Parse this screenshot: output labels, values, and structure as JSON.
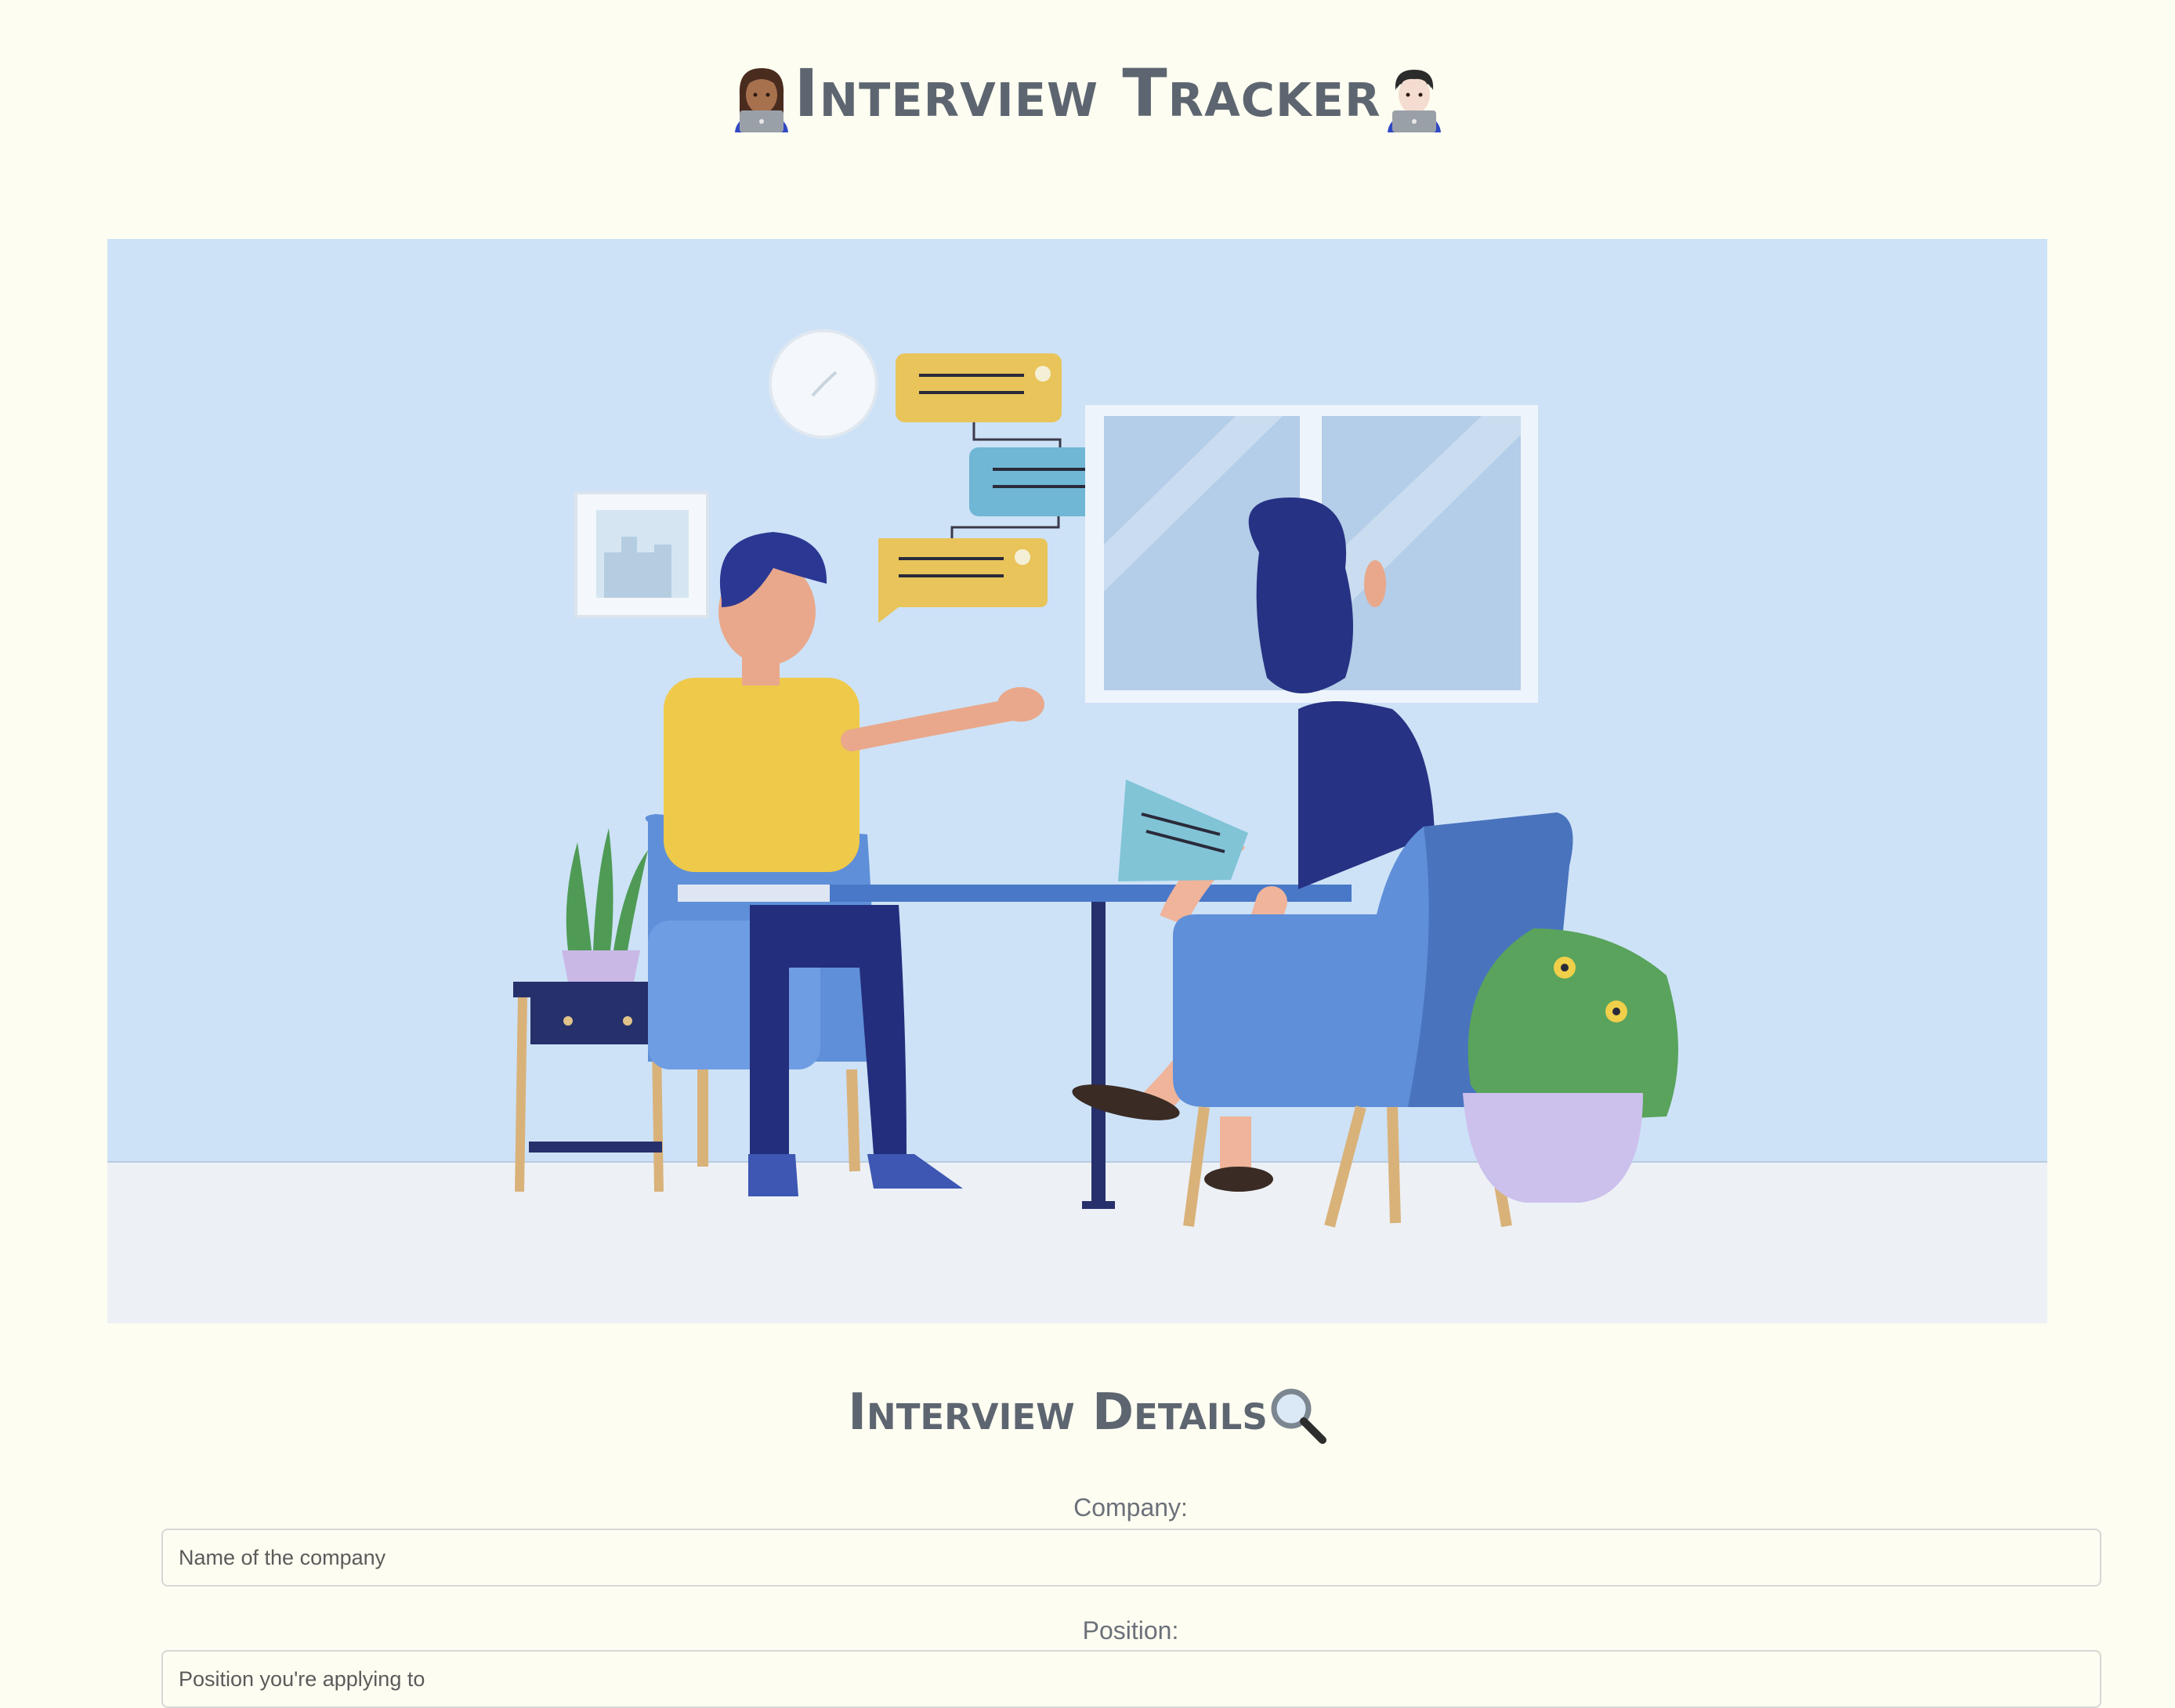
{
  "header": {
    "title": "Interview Tracker",
    "left_icon": "woman-technologist-icon",
    "right_icon": "man-technologist-icon"
  },
  "hero": {
    "image": "interview-illustration"
  },
  "details": {
    "title": "Interview Details",
    "title_icon": "magnifying-glass-icon",
    "company": {
      "label": "Company:",
      "placeholder": "Name of the company"
    },
    "position": {
      "label": "Position:",
      "placeholder": "Position you're applying to"
    }
  },
  "colors": {
    "background": "#fefdf1",
    "hero_wall": "#cde2f7",
    "hero_floor": "#edf1f6",
    "text": "#5d6670"
  }
}
